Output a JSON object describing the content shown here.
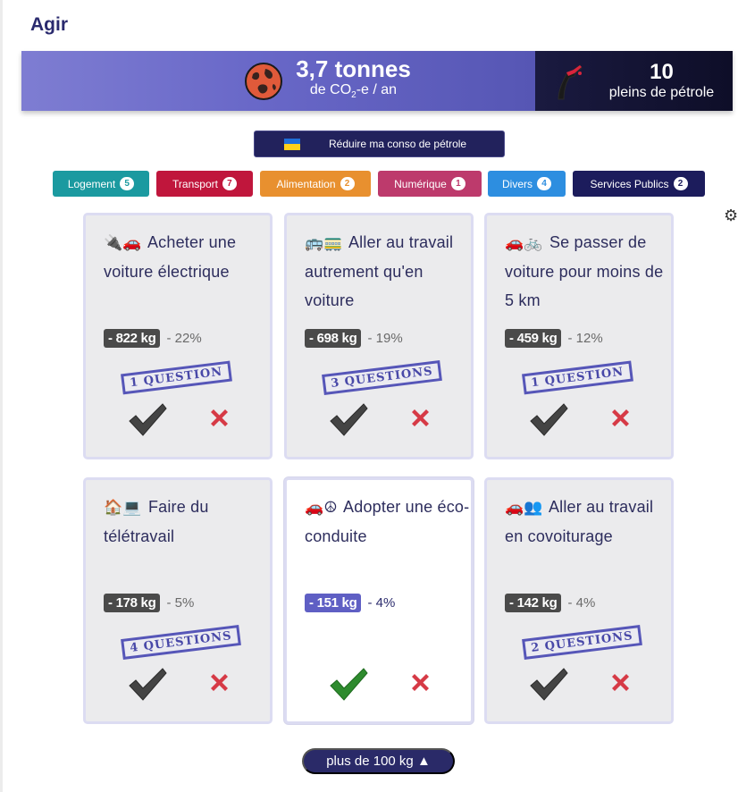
{
  "page": {
    "title": "Agir"
  },
  "banner": {
    "co2_amount": "3,7 tonnes",
    "co2_unit_prefix": "de CO",
    "co2_unit_sub": "2",
    "co2_unit_suffix": "-e / an",
    "petrol_count": "10",
    "petrol_label": "pleins de pétrole"
  },
  "petrol_button": {
    "label": "Réduire ma conso de pétrole"
  },
  "filters": [
    {
      "label": "Logement",
      "count": "5",
      "color": "#1b9aa0"
    },
    {
      "label": "Transport",
      "count": "7",
      "color": "#c0163c"
    },
    {
      "label": "Alimentation",
      "count": "2",
      "color": "#e8902f"
    },
    {
      "label": "Numérique",
      "count": "1",
      "color": "#bd3a6c"
    },
    {
      "label": "Divers",
      "count": "4",
      "color": "#2d8ee0"
    },
    {
      "label": "Services Publics",
      "count": "2",
      "color": "#1c1c5c"
    }
  ],
  "cards": [
    {
      "emoji": "🔌🚗",
      "title": "Acheter une voiture électrique",
      "kg": "- 822 kg",
      "pct": "- 22%",
      "questions": "1 QUESTION",
      "selected": false
    },
    {
      "emoji": "🚌🚃",
      "title": "Aller au travail autrement qu'en voiture",
      "kg": "- 698 kg",
      "pct": "- 19%",
      "questions": "3 QUESTIONS",
      "selected": false
    },
    {
      "emoji": "🚗🚲",
      "title": "Se passer de voiture pour moins de 5 km",
      "kg": "- 459 kg",
      "pct": "- 12%",
      "questions": "1 QUESTION",
      "selected": false
    },
    {
      "emoji": "🏠💻",
      "title": "Faire du télétravail",
      "kg": "- 178 kg",
      "pct": "- 5%",
      "questions": "4 QUESTIONS",
      "selected": false
    },
    {
      "emoji": "🚗☮",
      "title": "Adopter une éco-conduite",
      "kg": "- 151 kg",
      "pct": "- 4%",
      "questions": "",
      "selected": true
    },
    {
      "emoji": "🚗👥",
      "title": "Aller au travail en covoiturage",
      "kg": "- 142 kg",
      "pct": "- 4%",
      "questions": "2 QUESTIONS",
      "selected": false
    }
  ],
  "more_button": {
    "label": "plus de 100 kg ▲"
  },
  "colors": {
    "check_default": "#444444",
    "check_selected": "#2e8b2e",
    "cross": "#d63a46"
  }
}
